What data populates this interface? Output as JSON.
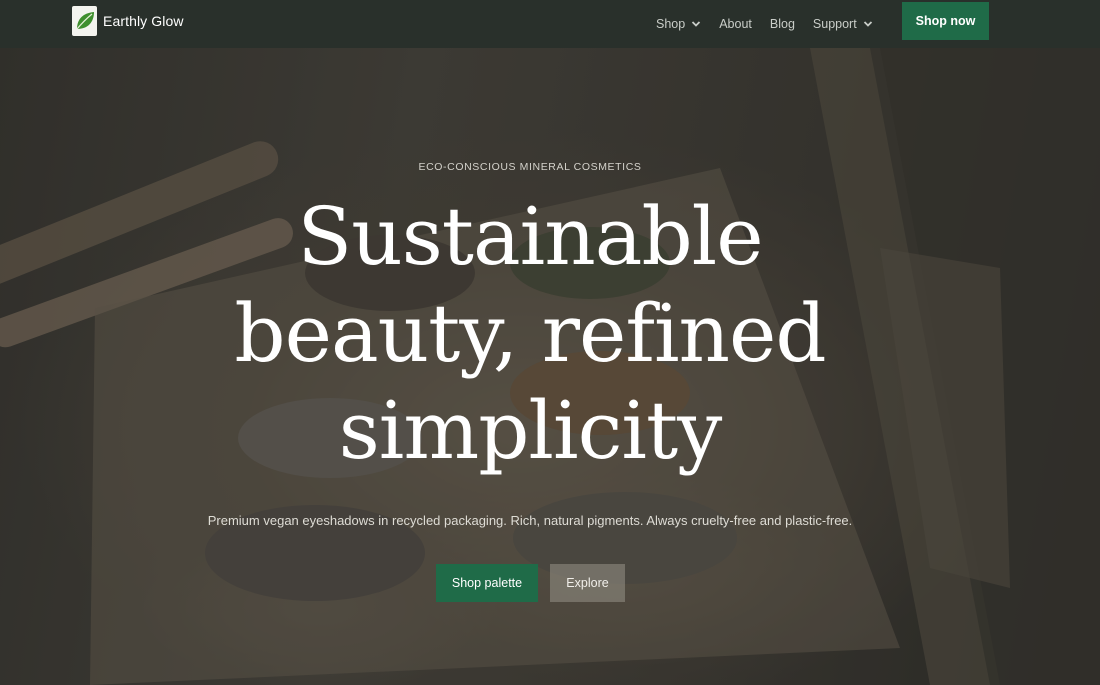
{
  "brand": {
    "name": "Earthly Glow",
    "logo_icon": "leaf-icon"
  },
  "nav": {
    "items": [
      {
        "label": "Shop",
        "has_dropdown": true
      },
      {
        "label": "About",
        "has_dropdown": false
      },
      {
        "label": "Blog",
        "has_dropdown": false
      },
      {
        "label": "Support",
        "has_dropdown": true
      }
    ],
    "cta_label": "Shop now"
  },
  "hero": {
    "eyebrow": "ECO-CONSCIOUS MINERAL COSMETICS",
    "headline_lines": [
      "Sustainable",
      "beauty, refined",
      "simplicity"
    ],
    "subtitle": "Premium vegan eyeshadows in recycled packaging. Rich, natural pigments. Always cruelty-free and plastic-free.",
    "primary_cta": "Shop palette",
    "secondary_cta": "Explore"
  },
  "colors": {
    "nav_bg": "#29302b",
    "accent": "#1f6b48",
    "text_light": "#ffffff"
  }
}
